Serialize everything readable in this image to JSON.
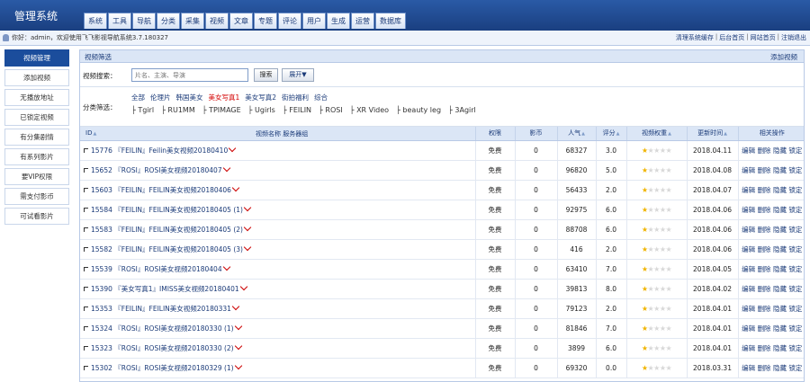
{
  "header": {
    "title": "管理系统",
    "nav": [
      "系统",
      "工具",
      "导航",
      "分类",
      "采集",
      "视频",
      "文章",
      "专题",
      "评论",
      "用户",
      "生成",
      "运营",
      "数据库"
    ]
  },
  "infobar": {
    "welcome": "你好：admin，欢迎使用飞飞影视导航系统3.7.180327",
    "links": [
      "清理系统缓存",
      "后台首页",
      "网站首页",
      "注销退出"
    ]
  },
  "sidebar": {
    "items": [
      "视频管理",
      "添加视频",
      "无播放地址",
      "已锁定视频",
      "有分集剧情",
      "有系列影片",
      "要VIP权限",
      "需支付影币",
      "可试看影片"
    ],
    "active_index": 0
  },
  "panel": {
    "title": "视频筛选",
    "add_label": "添加视频",
    "search_label": "视频搜索：",
    "search_placeholder": "片名、主演、导演",
    "search_button": "搜索",
    "expand_button": "展开▼",
    "category_label": "分类筛选：",
    "categories_line1": [
      "全部",
      "伦理片",
      "韩国美女",
      "美女写真1",
      "美女写真2",
      "街拍福利",
      "综合"
    ],
    "categories_selected": "美女写真1",
    "categories_line2": [
      "├ Tgirl",
      "├ RU1MM",
      "├ TPIMAGE",
      "├ Ugirls",
      "├ FEILIN",
      "├ ROSI",
      "├ XR Video",
      "├ beauty leg",
      "├ 3Agirl"
    ]
  },
  "table": {
    "columns": [
      "ID",
      "视频名称 服务器组",
      "权限",
      "影币",
      "人气",
      "评分",
      "视频权重",
      "更新时间",
      "相关操作"
    ],
    "ops": [
      "编辑",
      "删除",
      "隐藏",
      "锁定"
    ],
    "rows": [
      {
        "id": "15776",
        "name": "『FEILIN』Feilin美女视频20180410",
        "src": "33uu",
        "perm": "免费",
        "coin": "0",
        "pop": "68327",
        "score": "3.0",
        "stars": 1,
        "date": "2018.04.11"
      },
      {
        "id": "15652",
        "name": "『ROSI』ROSI美女视频20180407",
        "src": "33uu",
        "perm": "免费",
        "coin": "0",
        "pop": "96820",
        "score": "5.0",
        "stars": 1,
        "date": "2018.04.08"
      },
      {
        "id": "15603",
        "name": "『FEILIN』FEILIN美女视频20180406",
        "src": "33uu",
        "perm": "免费",
        "coin": "0",
        "pop": "56433",
        "score": "2.0",
        "stars": 1,
        "date": "2018.04.07"
      },
      {
        "id": "15584",
        "name": "『FEILIN』FEILIN美女视频20180405 (1)",
        "src": "33uu",
        "perm": "免费",
        "coin": "0",
        "pop": "92975",
        "score": "6.0",
        "stars": 1,
        "date": "2018.04.06"
      },
      {
        "id": "15583",
        "name": "『FEILIN』FEILIN美女视频20180405 (2)",
        "src": "33uu",
        "perm": "免费",
        "coin": "0",
        "pop": "88708",
        "score": "6.0",
        "stars": 1,
        "date": "2018.04.06"
      },
      {
        "id": "15582",
        "name": "『FEILIN』FEILIN美女视频20180405 (3)",
        "src": "33uu",
        "perm": "免费",
        "coin": "0",
        "pop": "416",
        "score": "2.0",
        "stars": 1,
        "date": "2018.04.06"
      },
      {
        "id": "15539",
        "name": "『ROSI』ROSI美女视频20180404",
        "src": "33uu",
        "perm": "免费",
        "coin": "0",
        "pop": "63410",
        "score": "7.0",
        "stars": 1,
        "date": "2018.04.05"
      },
      {
        "id": "15390",
        "name": "『美女写真1』IMISS美女视频20180401",
        "src": "33uu",
        "perm": "免费",
        "coin": "0",
        "pop": "39813",
        "score": "8.0",
        "stars": 1,
        "date": "2018.04.02"
      },
      {
        "id": "15353",
        "name": "『FEILIN』FEILIN美女视频20180331",
        "src": "33uu",
        "perm": "免费",
        "coin": "0",
        "pop": "79123",
        "score": "2.0",
        "stars": 1,
        "date": "2018.04.01"
      },
      {
        "id": "15324",
        "name": "『ROSI』ROSI美女视频20180330 (1)",
        "src": "33uu",
        "perm": "免费",
        "coin": "0",
        "pop": "81846",
        "score": "7.0",
        "stars": 1,
        "date": "2018.04.01"
      },
      {
        "id": "15323",
        "name": "『ROSI』ROSI美女视频20180330 (2)",
        "src": "33uu",
        "perm": "免费",
        "coin": "0",
        "pop": "3899",
        "score": "6.0",
        "stars": 1,
        "date": "2018.04.01"
      },
      {
        "id": "15302",
        "name": "『ROSI』ROSI美女视频20180329 (1)",
        "src": "33uu",
        "perm": "免费",
        "coin": "0",
        "pop": "69320",
        "score": "0.0",
        "stars": 1,
        "date": "2018.03.31"
      }
    ]
  },
  "colors": {
    "brand": "#1b4d9c",
    "accent": "#1a3a78",
    "selected_category": "#d30000",
    "star_on": "#f0b400"
  }
}
